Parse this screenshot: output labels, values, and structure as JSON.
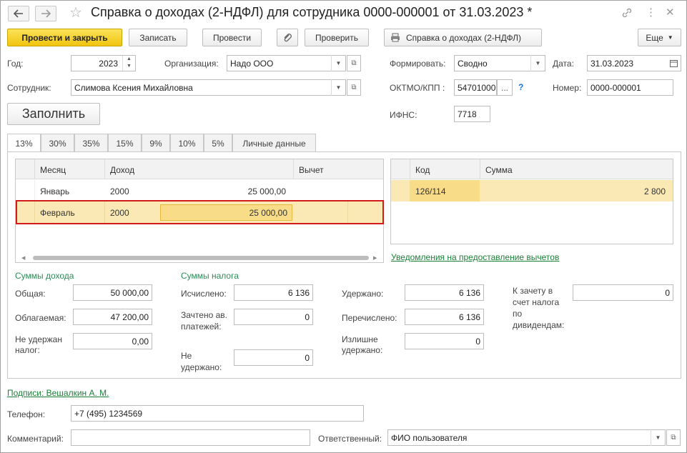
{
  "window": {
    "title": "Справка о доходах (2-НДФЛ) для сотрудника 0000-000001 от 31.03.2023 *"
  },
  "icons": {
    "back": "arrow-left-icon",
    "forward": "arrow-right-icon",
    "favorite": "star-icon",
    "link": "link-icon",
    "more": "more-vertical-icon",
    "close": "close-icon",
    "attach": "paperclip-icon",
    "print": "printer-icon",
    "help": "question-icon"
  },
  "toolbar": {
    "post_close": "Провести и закрыть",
    "save": "Записать",
    "post": "Провести",
    "check": "Проверить",
    "print_report": "Справка о доходах (2-НДФЛ)",
    "more": "Еще"
  },
  "form": {
    "year_label": "Год:",
    "year_value": "2023",
    "org_label": "Организация:",
    "org_value": "Надо ООО",
    "form_label": "Формировать:",
    "form_value": "Сводно",
    "date_label": "Дата:",
    "date_value": "31.03.2023",
    "employee_label": "Сотрудник:",
    "employee_value": "Слимова Ксения Михайловна",
    "oktmo_label": "ОКТМО/КПП :",
    "oktmo_value": "54701000",
    "oktmo_more": "...",
    "help_mark": "?",
    "number_label": "Номер:",
    "number_value": "0000-000001",
    "fill_button": "Заполнить",
    "ifns_label": "ИФНС:",
    "ifns_value": "7718"
  },
  "tabs": [
    "13%",
    "30%",
    "35%",
    "15%",
    "9%",
    "10%",
    "5%",
    "Личные данные"
  ],
  "income_table": {
    "columns": [
      "Месяц",
      "Доход",
      "Вычет"
    ],
    "rows": [
      {
        "month": "Январь",
        "code": "2000",
        "amount": "25 000,00"
      },
      {
        "month": "Февраль",
        "code": "2000",
        "amount": "25 000,00"
      }
    ]
  },
  "deduction_table": {
    "columns": [
      "Код",
      "Сумма"
    ],
    "rows": [
      {
        "code": "126/114",
        "sum": "2 800"
      }
    ]
  },
  "notices_link": "Уведомления на предоставление вычетов",
  "income_sums": {
    "title": "Суммы дохода",
    "total_label": "Общая:",
    "total_value": "50 000,00",
    "taxable_label": "Облагаемая:",
    "taxable_value": "47 200,00",
    "not_withheld_label": "Не удержан налог:",
    "not_withheld_value": "0,00"
  },
  "tax_sums": {
    "title": "Суммы налога",
    "calculated_label": "Исчислено:",
    "calculated_value": "6 136",
    "offset_label": "Зачтено ав. платежей:",
    "offset_value": "0",
    "not_withheld_label": "Не удержано:",
    "not_withheld_value": "0",
    "withheld_label": "Удержано:",
    "withheld_value": "6 136",
    "transferred_label": "Перечислено:",
    "transferred_value": "6 136",
    "excess_label": "Излишне удержано:",
    "excess_value": "0",
    "dividend_label": "К зачету в счет налога по дивидендам:",
    "dividend_value": "0"
  },
  "footer": {
    "signatures_link": "Подписи: Вешалкин А. М.",
    "phone_label": "Телефон:",
    "phone_value": "+7 (495) 1234569",
    "comment_label": "Комментарий:",
    "comment_value": "",
    "responsible_label": "Ответственный:",
    "responsible_value": "ФИО пользователя"
  },
  "colors": {
    "primary_button": "#f1c40f",
    "selected_row": "#fbe9b5",
    "selected_cell": "#f8dc88",
    "highlight_border": "#d21c1c",
    "link": "#1a7f37",
    "section_title": "#2e8b57"
  }
}
